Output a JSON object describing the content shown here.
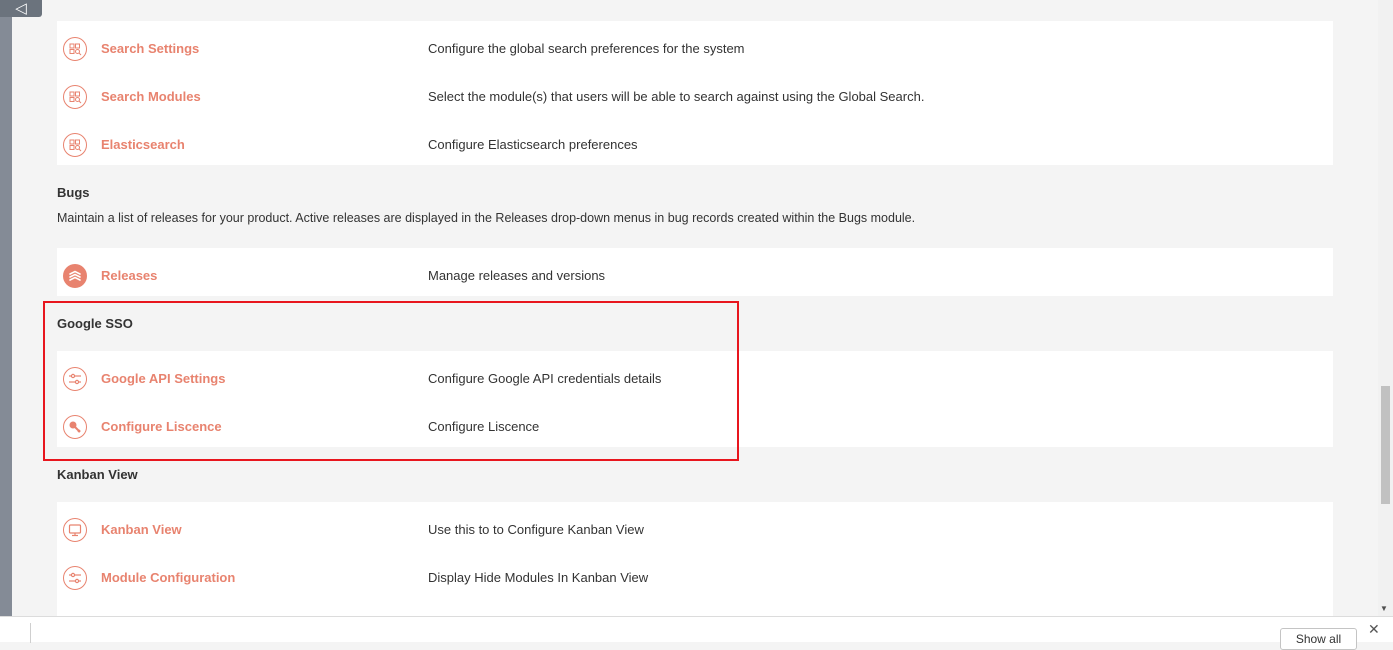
{
  "nav": {
    "back_icon": "◁"
  },
  "search": {
    "rows": [
      {
        "icon": "search-settings-icon",
        "label": "Search Settings",
        "desc": "Configure the global search preferences for the system"
      },
      {
        "icon": "search-modules-icon",
        "label": "Search Modules",
        "desc": "Select the module(s) that users will be able to search against using the Global Search."
      },
      {
        "icon": "elasticsearch-icon",
        "label": "Elasticsearch",
        "desc": "Configure Elasticsearch preferences"
      }
    ]
  },
  "bugs": {
    "title": "Bugs",
    "description": "Maintain a list of releases for your product. Active releases are displayed in the Releases drop-down menus in bug records created within the Bugs module.",
    "rows": [
      {
        "icon": "releases-icon",
        "label": "Releases",
        "desc": "Manage releases and versions"
      }
    ]
  },
  "google_sso": {
    "title": "Google SSO",
    "rows": [
      {
        "icon": "sliders-icon",
        "label": "Google API Settings",
        "desc": "Configure Google API credentials details"
      },
      {
        "icon": "key-icon",
        "label": "Configure Liscence",
        "desc": "Configure Liscence"
      }
    ]
  },
  "kanban": {
    "title": "Kanban View",
    "rows": [
      {
        "icon": "monitor-icon",
        "label": "Kanban View",
        "desc": "Use this to to Configure Kanban View"
      },
      {
        "icon": "sliders-icon",
        "label": "Module Configuration",
        "desc": "Display Hide Modules In Kanban View"
      }
    ]
  },
  "bottom_bar": {
    "show_all_label": "Show all",
    "close_icon": "✕"
  },
  "colors": {
    "accent": "#e8836f",
    "highlight": "#e8161e",
    "rail": "#848b96"
  }
}
